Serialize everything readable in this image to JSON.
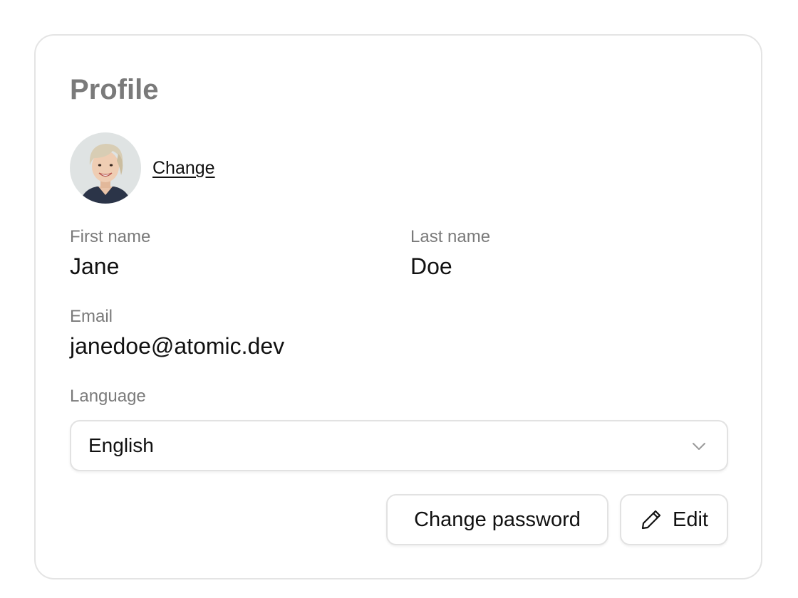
{
  "card": {
    "title": "Profile"
  },
  "avatar": {
    "icon": "user-photo",
    "change_label": "Change"
  },
  "fields": {
    "first_name": {
      "label": "First name",
      "value": "Jane"
    },
    "last_name": {
      "label": "Last name",
      "value": "Doe"
    },
    "email": {
      "label": "Email",
      "value": "janedoe@atomic.dev"
    },
    "language": {
      "label": "Language",
      "value": "English",
      "icon": "chevron-down-icon"
    }
  },
  "actions": {
    "change_password_label": "Change password",
    "edit_label": "Edit",
    "edit_icon": "pencil-icon"
  },
  "colors": {
    "muted_text": "#7a7a7a",
    "primary_text": "#111111",
    "border": "#e4e4e4"
  }
}
